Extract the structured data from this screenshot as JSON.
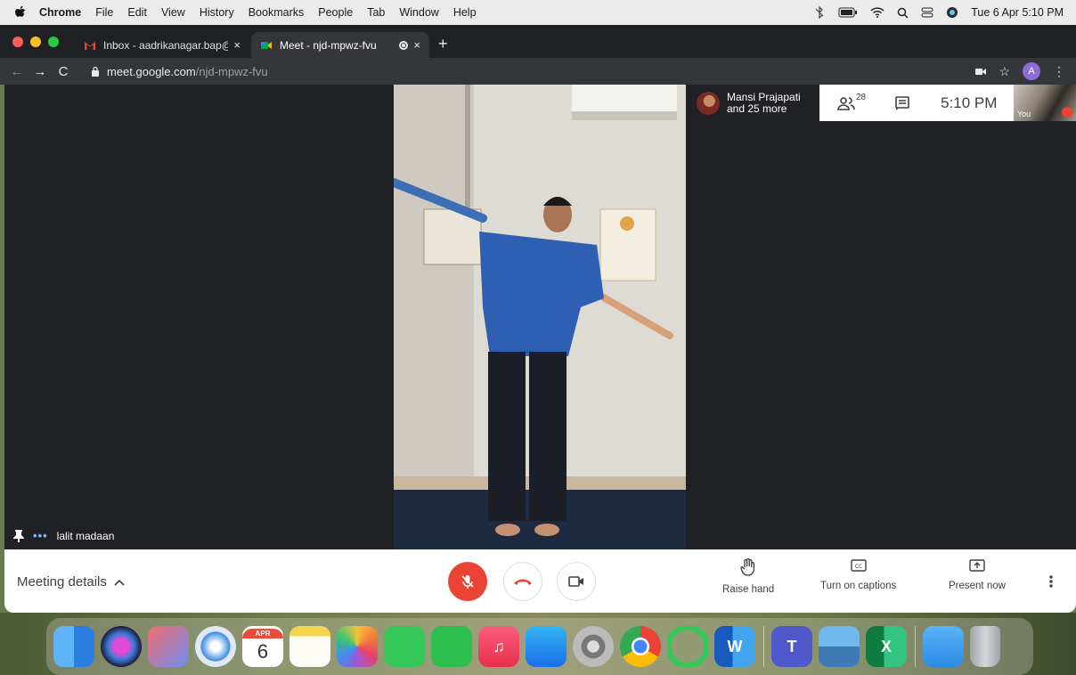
{
  "menubar": {
    "app": "Chrome",
    "items": [
      "File",
      "Edit",
      "View",
      "History",
      "Bookmarks",
      "People",
      "Tab",
      "Window",
      "Help"
    ],
    "clock": "Tue 6 Apr  5:10 PM"
  },
  "tabs": [
    {
      "title": "Inbox - aadrikanagar.bap@knc",
      "close": "×"
    },
    {
      "title": "Meet - njd-mpwz-fvu",
      "close": "×"
    }
  ],
  "newtab": "+",
  "address": {
    "domain": "meet.google.com",
    "path": "/njd-mpwz-fvu"
  },
  "profile_initial": "A",
  "meet": {
    "participant_name": "lalit madaan",
    "speaker_dots": "•••",
    "people_chip": {
      "line1": "Mansi Prajapati",
      "line2": "and 25 more"
    },
    "participant_count": "28",
    "time": "5:10 PM",
    "self_label": "You"
  },
  "controls": {
    "meeting_details": "Meeting details",
    "raise_hand": "Raise hand",
    "captions": "Turn on captions",
    "present": "Present now"
  },
  "dock": {
    "calendar_month": "APR",
    "calendar_day": "6",
    "word_letter": "W",
    "teams_letter": "T",
    "excel_letter": "X"
  }
}
